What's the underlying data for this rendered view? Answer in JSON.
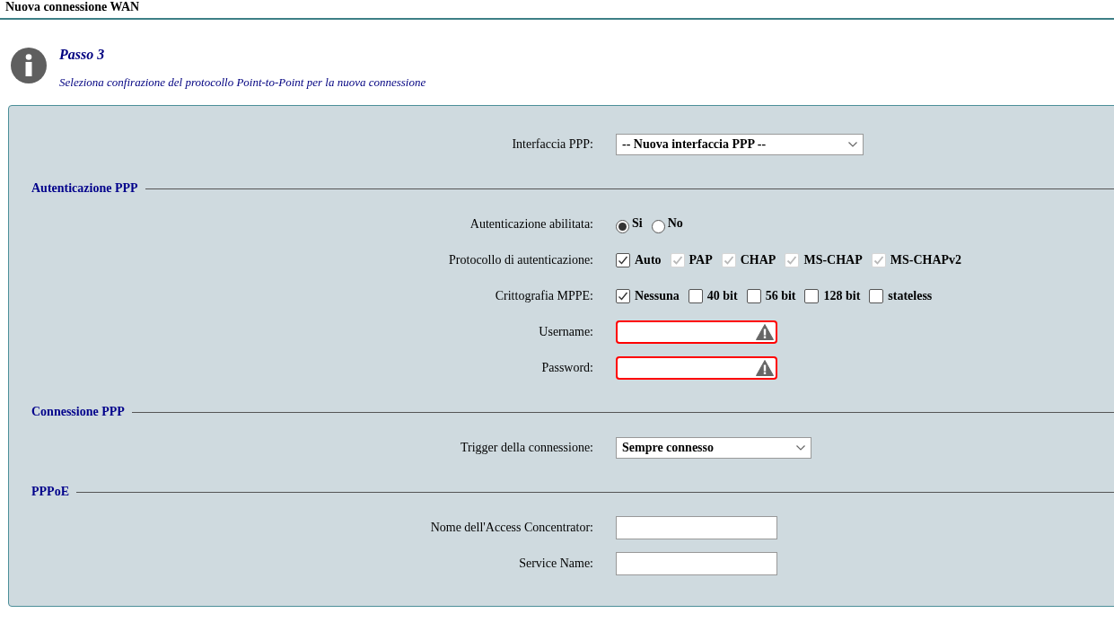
{
  "page_title": "Nuova connessione WAN",
  "step": {
    "title": "Passo 3",
    "description": "Seleziona confirazione del protocollo Point-to-Point per la nuova connessione"
  },
  "form": {
    "top_rows": [
      {
        "kind": "select",
        "label": "Interfaccia PPP:",
        "value": "-- Nuova interfaccia PPP --"
      }
    ],
    "sections": [
      {
        "title": "Autenticazione PPP",
        "rows": [
          {
            "kind": "radio",
            "label": "Autenticazione abilitata:",
            "options": [
              {
                "label": "Si",
                "selected": true
              },
              {
                "label": "No",
                "selected": false
              }
            ]
          },
          {
            "kind": "checkbox",
            "label": "Protocollo di autenticazione:",
            "options": [
              {
                "label": "Auto",
                "checked": true,
                "disabled": false
              },
              {
                "label": "PAP",
                "checked": true,
                "disabled": true
              },
              {
                "label": "CHAP",
                "checked": true,
                "disabled": true
              },
              {
                "label": "MS-CHAP",
                "checked": true,
                "disabled": true
              },
              {
                "label": "MS-CHAPv2",
                "checked": true,
                "disabled": true
              }
            ]
          },
          {
            "kind": "checkbox",
            "label": "Crittografia MPPE:",
            "options": [
              {
                "label": "Nessuna",
                "checked": true,
                "disabled": false
              },
              {
                "label": "40 bit",
                "checked": false,
                "disabled": false
              },
              {
                "label": "56 bit",
                "checked": false,
                "disabled": false
              },
              {
                "label": "128 bit",
                "checked": false,
                "disabled": false
              },
              {
                "label": "stateless",
                "checked": false,
                "disabled": false
              }
            ]
          },
          {
            "kind": "text",
            "label": "Username:",
            "invalid": true
          },
          {
            "kind": "text",
            "label": "Password:",
            "invalid": true
          }
        ]
      },
      {
        "title": "Connessione PPP",
        "rows": [
          {
            "kind": "select",
            "label": "Trigger della connessione:",
            "value": "Sempre connesso"
          }
        ]
      },
      {
        "title": "PPPoE",
        "rows": [
          {
            "kind": "text",
            "label": "Nome dell'Access Concentrator:",
            "invalid": false
          },
          {
            "kind": "text",
            "label": "Service Name:",
            "invalid": false
          }
        ]
      }
    ]
  }
}
